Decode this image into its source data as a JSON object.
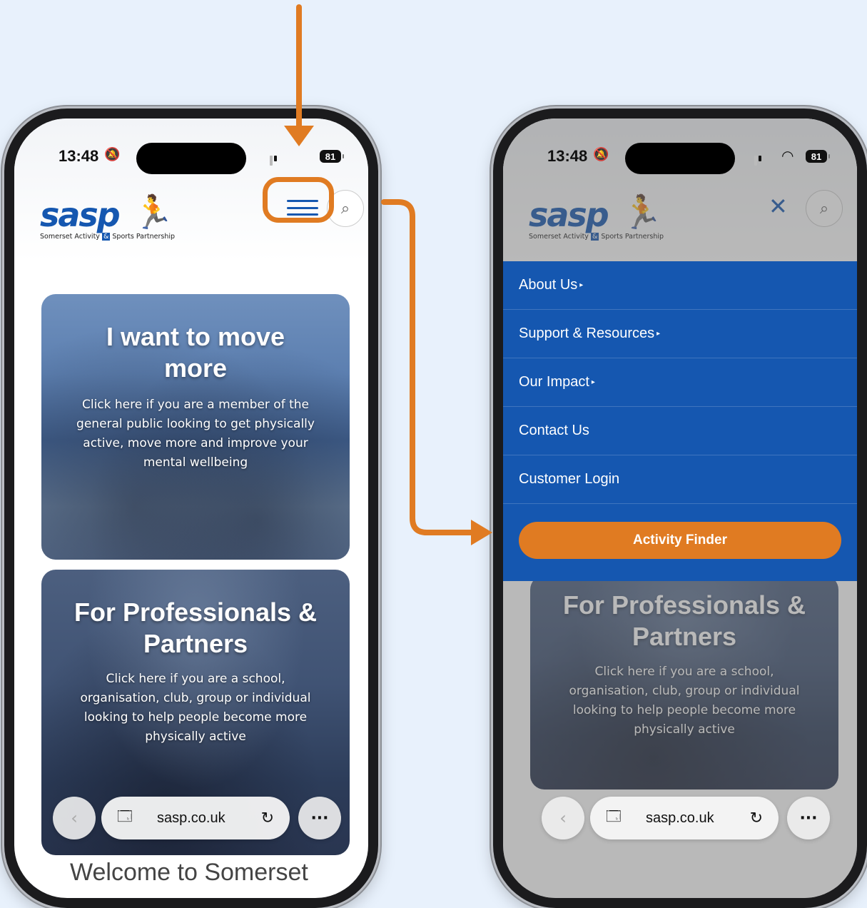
{
  "status": {
    "time": "13:48",
    "battery": "81"
  },
  "site": {
    "logo_word": "sasp",
    "logo_tagline_a": "Somerset Activity ",
    "logo_tagline_amp": "&",
    "logo_tagline_b": " Sports Partnership"
  },
  "cards": {
    "move_title": "I want to move more",
    "move_text": "Click here if you are a member of the general public looking to get physically active, move more and improve your mental wellbeing",
    "pro_title": "For Professionals & Partners",
    "pro_text": "Click here if you are a school, organisation, club, group or individual looking to help people become more physically active"
  },
  "browser": {
    "url": "sasp.co.uk"
  },
  "welcome": "Welcome to Somerset",
  "menu": {
    "items": [
      {
        "label": "About Us",
        "has_submenu": true
      },
      {
        "label": "Support & Resources",
        "has_submenu": true
      },
      {
        "label": "Our Impact",
        "has_submenu": true
      },
      {
        "label": "Contact Us",
        "has_submenu": false
      },
      {
        "label": "Customer Login",
        "has_submenu": false
      }
    ],
    "cta": "Activity Finder"
  },
  "colors": {
    "brand_blue": "#1557b0",
    "accent_orange": "#e07b22",
    "background": "#e8f1fc"
  },
  "icons": [
    "menu-icon",
    "search-icon",
    "close-icon",
    "back-icon",
    "reader-icon",
    "reload-icon",
    "more-icon",
    "arrow-icon"
  ]
}
